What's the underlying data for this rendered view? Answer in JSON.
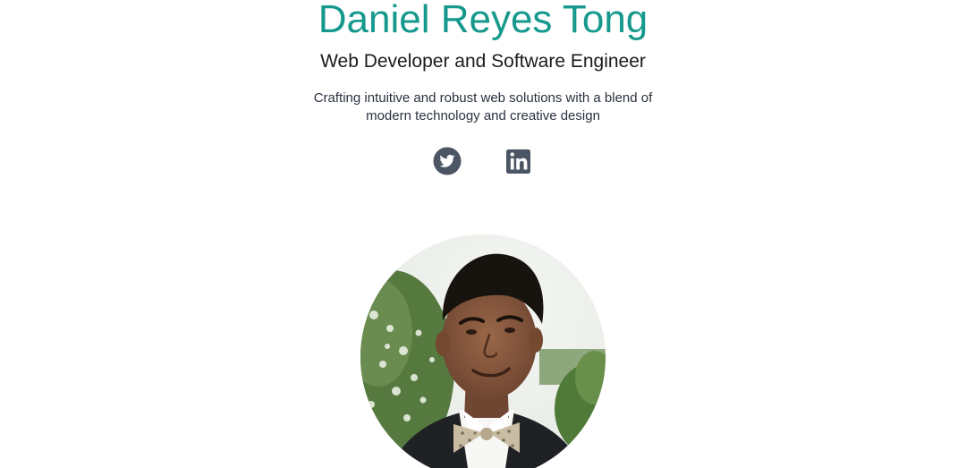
{
  "profile": {
    "name": "Daniel Reyes Tong",
    "role": "Web Developer and Software Engineer",
    "tagline": "Crafting intuitive and robust web solutions with a blend of modern technology and creative design"
  },
  "socials": [
    {
      "icon": "twitter-icon",
      "label": "Twitter"
    },
    {
      "icon": "linkedin-icon",
      "label": "LinkedIn"
    }
  ],
  "colors": {
    "accent": "#16998c",
    "icon": "#4b5563",
    "text": "#1b1b1f"
  }
}
